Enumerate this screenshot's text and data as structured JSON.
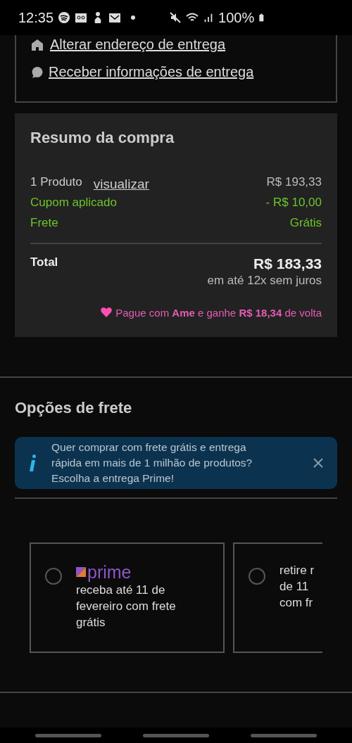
{
  "status_bar": {
    "time": "12:35",
    "battery": "100%"
  },
  "delivery_links": [
    {
      "label": "Alterar endereço de entrega",
      "kind": "home"
    },
    {
      "label": "Receber informações de entrega",
      "kind": "whatsapp"
    }
  ],
  "summary": {
    "title": "Resumo da compra",
    "rows": [
      {
        "label": "1 Produto",
        "link": "visualizar",
        "value": "R$ 193,33",
        "kind": "normal"
      },
      {
        "label": "Cupom aplicado",
        "value": "- R$ 10,00",
        "kind": "discount"
      },
      {
        "label": "Frete",
        "value": "Grátis",
        "kind": "discount"
      }
    ],
    "total_label": "Total",
    "total_value": "R$ 183,33",
    "installments": "em até 12x sem juros",
    "cashback": "Pague com **Ame** e ganhe **R$ 18,34** de volta"
  },
  "shipping": {
    "title": "Opções de frete",
    "banner": {
      "lines": [
        "Quer comprar com frete grátis e entrega",
        "rápida em mais de 1 milhão de produtos?",
        "Escolha a entrega Prime!"
      ]
    },
    "options": [
      {
        "brand": "prime",
        "lines": [
          "receba até 11 de",
          "fevereiro com frete",
          "grátis"
        ],
        "selected": false
      },
      {
        "lines": [
          "retire r",
          "de 11",
          "com fr"
        ],
        "selected": false
      }
    ]
  }
}
